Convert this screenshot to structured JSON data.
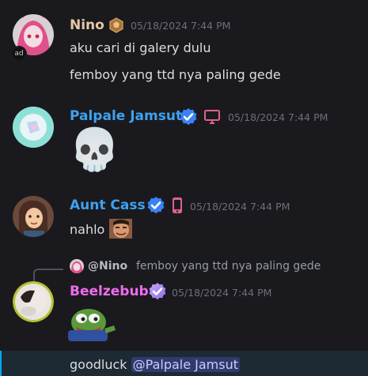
{
  "messages": [
    {
      "author": "Nino",
      "timestamp": "05/18/2024 7:44 PM",
      "lines": [
        "aku cari di galery dulu",
        "femboy yang ttd nya paling gede"
      ]
    },
    {
      "author": "Palpale Jamsut",
      "timestamp": "05/18/2024 7:44 PM",
      "emoji": "💀"
    },
    {
      "author": "Aunt Cass",
      "timestamp": "05/18/2024 7:44 PM",
      "text": "nahlo"
    },
    {
      "reply": {
        "author": "@Nino",
        "text": "femboy yang ttd nya paling gede"
      },
      "author": "Beelzebub",
      "timestamp": "05/18/2024 7:44 PM",
      "text_prefix": "goodluck",
      "mention": "@Palpale Jamsut"
    }
  ],
  "colors": {
    "nino": "#e8c8a8",
    "palpale": "#3ea2f0",
    "aunt_cass": "#3ea2f0",
    "beelzebub": "#f06bf0",
    "verified": "#3b82f6",
    "device_icon": "#e06090"
  },
  "icons": {
    "nino_badge": "hexagon-rank-icon",
    "verified": "verified-check-icon",
    "desktop": "desktop-monitor-icon",
    "mobile": "mobile-phone-icon"
  }
}
